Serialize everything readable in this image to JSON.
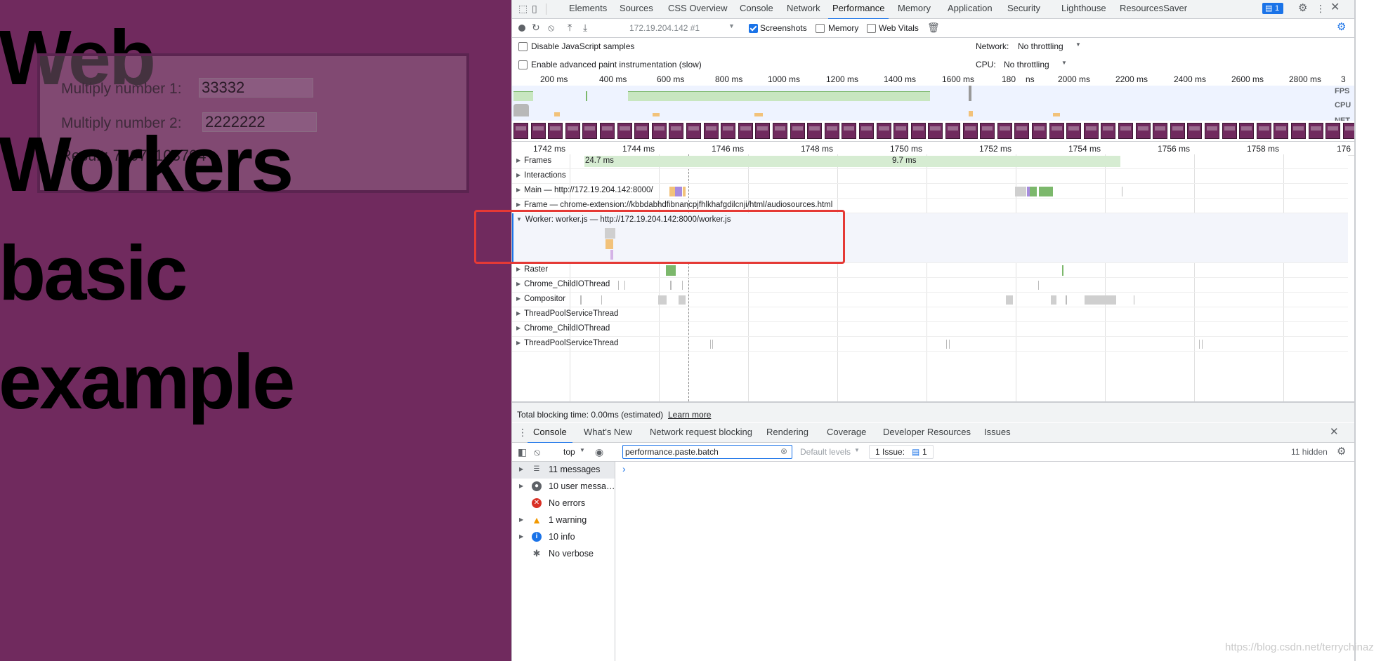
{
  "page": {
    "heading_lines": [
      "Web",
      "Workers",
      "basic",
      "example"
    ],
    "label1": "Multiply number 1:",
    "value1": "33332",
    "label2": "Multiply number 2:",
    "value2": "2222222",
    "result": "Result: 74071103704"
  },
  "devtools": {
    "tabs": [
      "Elements",
      "Sources",
      "CSS Overview",
      "Console",
      "Network",
      "Performance",
      "Memory",
      "Application",
      "Security",
      "Lighthouse",
      "ResourcesSaver"
    ],
    "active_tab": "Performance",
    "issues_badge": "1",
    "perf_toolbar": {
      "recording": "172.19.204.142 #1",
      "screenshots": "Screenshots",
      "memory": "Memory",
      "web_vitals": "Web Vitals"
    },
    "settings": {
      "disable_js": "Disable JavaScript samples",
      "adv_paint": "Enable advanced paint instrumentation (slow)",
      "network_label": "Network:",
      "network_value": "No throttling",
      "cpu_label": "CPU:",
      "cpu_value": "No throttling"
    },
    "overview_ticks": [
      "200 ms",
      "400 ms",
      "600 ms",
      "800 ms",
      "1000 ms",
      "1200 ms",
      "1400 ms",
      "1600 ms",
      "180",
      "ns",
      "2000 ms",
      "2200 ms",
      "2400 ms",
      "2600 ms",
      "2800 ms",
      "3"
    ],
    "overview_labels": [
      "FPS",
      "CPU",
      "NET"
    ],
    "detail_ticks": [
      "1742 ms",
      "1744 ms",
      "1746 ms",
      "1748 ms",
      "1750 ms",
      "1752 ms",
      "1754 ms",
      "1756 ms",
      "1758 ms",
      "176"
    ],
    "frames_label": "Frames",
    "frame_times": [
      "24.7 ms",
      "9.7 ms"
    ],
    "tracks": [
      "Interactions",
      "Main — http://172.19.204.142:8000/",
      "Frame — chrome-extension://kbbdabhdfibnancpjfhlkhafgdilcnji/html/audiosources.html",
      "Worker: worker.js — http://172.19.204.142:8000/worker.js",
      "Raster",
      "Chrome_ChildIOThread",
      "Compositor",
      "ThreadPoolServiceThread",
      "Chrome_ChildIOThread",
      "ThreadPoolServiceThread"
    ],
    "tbt_text": "Total blocking time: 0.00ms (estimated)",
    "learn_more": "Learn more",
    "drawer_tabs": [
      "Console",
      "What's New",
      "Network request blocking",
      "Rendering",
      "Coverage",
      "Developer Resources",
      "Issues"
    ],
    "console": {
      "context": "top",
      "filter": "performance.paste.batch",
      "levels": "Default levels",
      "issue_label": "1 Issue:",
      "issue_count": "1",
      "hidden": "11 hidden",
      "prompt": "›"
    },
    "sidebar": [
      {
        "label": "11 messages",
        "icon": "list-icon"
      },
      {
        "label": "10 user messa…",
        "icon": "user-icon"
      },
      {
        "label": "No errors",
        "icon": "error-icon"
      },
      {
        "label": "1 warning",
        "icon": "warning-icon"
      },
      {
        "label": "10 info",
        "icon": "info-icon"
      },
      {
        "label": "No verbose",
        "icon": "bug-icon"
      }
    ]
  },
  "watermark": "https://blog.csdn.net/terrychinaz",
  "colors": {
    "page_bg": "#702a5e",
    "highlight": "#e53935",
    "accent": "#1a73e8"
  }
}
